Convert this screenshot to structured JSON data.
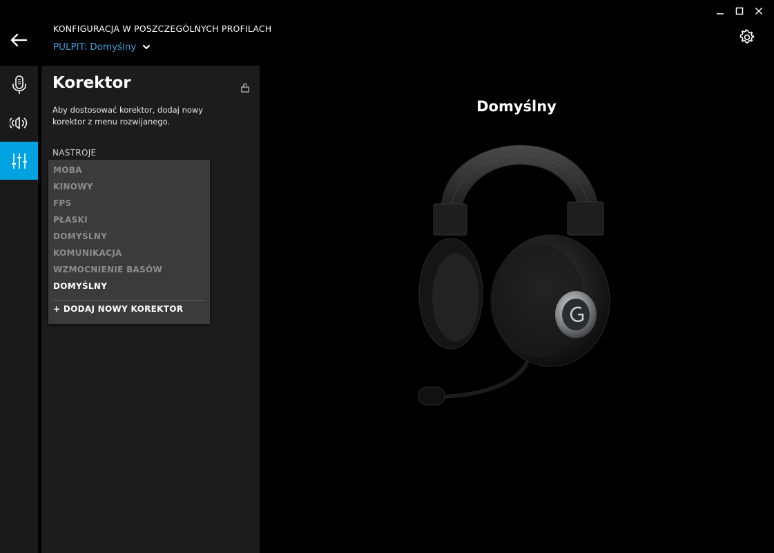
{
  "window": {
    "minimize_icon": "minimize-icon",
    "maximize_icon": "maximize-icon",
    "close_icon": "close-icon"
  },
  "header": {
    "title": "KONFIGURACJA W POSZCZEGÓLNYCH PROFILACH",
    "profile_selector": "PULPIT: Domyślny",
    "back_icon": "arrow-left-icon",
    "settings_icon": "gear-icon"
  },
  "rail": {
    "items": [
      {
        "icon": "microphone-icon"
      },
      {
        "icon": "speaker-icon"
      },
      {
        "icon": "equalizer-icon",
        "active": true
      }
    ],
    "accent": "#00a2e0"
  },
  "panel": {
    "title": "Korektor",
    "lock_icon": "unlock-icon",
    "description": "Aby dostosować korektor, dodaj nowy korektor z menu rozwijanego.",
    "presets_label": "NASTROJE",
    "presets": [
      "MOBA",
      "KINOWY",
      "FPS",
      "PŁASKI",
      "DOMYŚLNY",
      "KOMUNIKACJA",
      "WZMOCNIENIE BASÓW",
      "DOMYŚLNY"
    ],
    "selected_index": 7,
    "add_label": "+ DODAJ NOWY KOREKTOR"
  },
  "main": {
    "device_name": "Domyślny"
  }
}
